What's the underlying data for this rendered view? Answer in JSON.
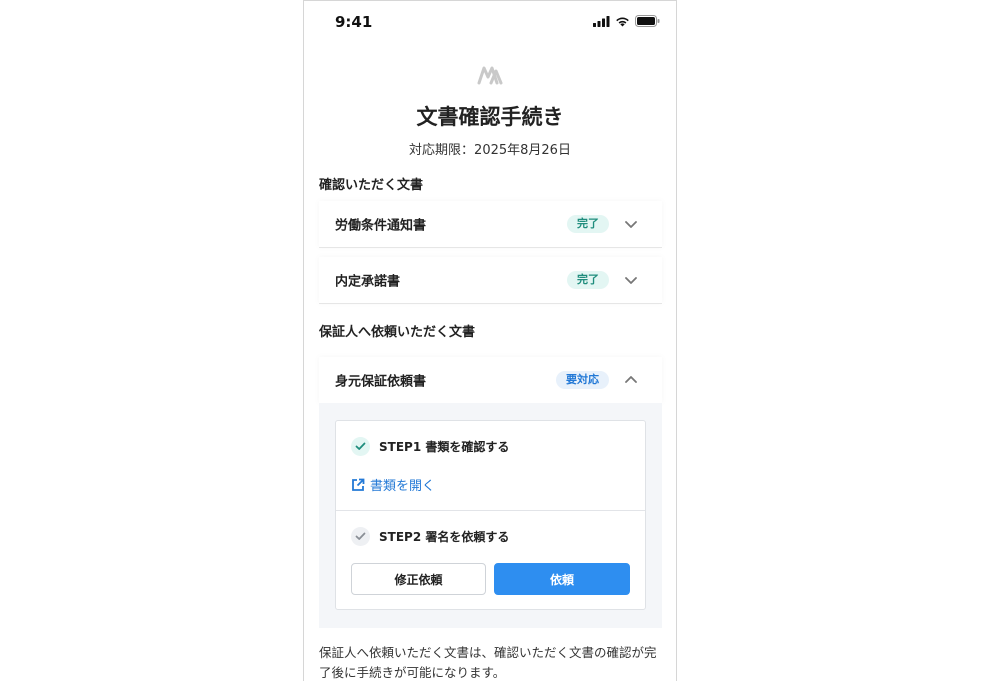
{
  "status_bar": {
    "time": "9:41"
  },
  "header": {
    "title": "文書確認手続き",
    "deadline": "対応期限：2025年8月26日"
  },
  "sections": {
    "confirm": {
      "label": "確認いただく文書",
      "items": [
        {
          "name": "労働条件通知書",
          "status": "完了"
        },
        {
          "name": "内定承諾書",
          "status": "完了"
        }
      ]
    },
    "guarantor": {
      "label": "保証人へ依頼いただく文書",
      "items": [
        {
          "name": "身元保証依頼書",
          "status": "要対応"
        }
      ]
    }
  },
  "steps": {
    "step1": {
      "title": "STEP1 書類を確認する",
      "link": "書類を開く"
    },
    "step2": {
      "title": "STEP2 署名を依頼する",
      "revise_button": "修正依頼",
      "request_button": "依頼"
    }
  },
  "note": "保証人へ依頼いただく文書は、確認いただく文書の確認が完了後に手続きが可能になります。",
  "colors": {
    "accent": "#2e8ef0",
    "done_badge_bg": "#e3f6f3",
    "done_badge_text": "#1f8d7d",
    "todo_badge_bg": "#e8f1fb",
    "todo_badge_text": "#2379d6"
  },
  "icons": {
    "logo": "brand-logo-icon",
    "signal": "signal-icon",
    "wifi": "wifi-icon",
    "battery": "battery-icon",
    "chevron_down": "chevron-down-icon",
    "chevron_up": "chevron-up-icon",
    "check": "check-icon",
    "external_link": "external-link-icon"
  }
}
